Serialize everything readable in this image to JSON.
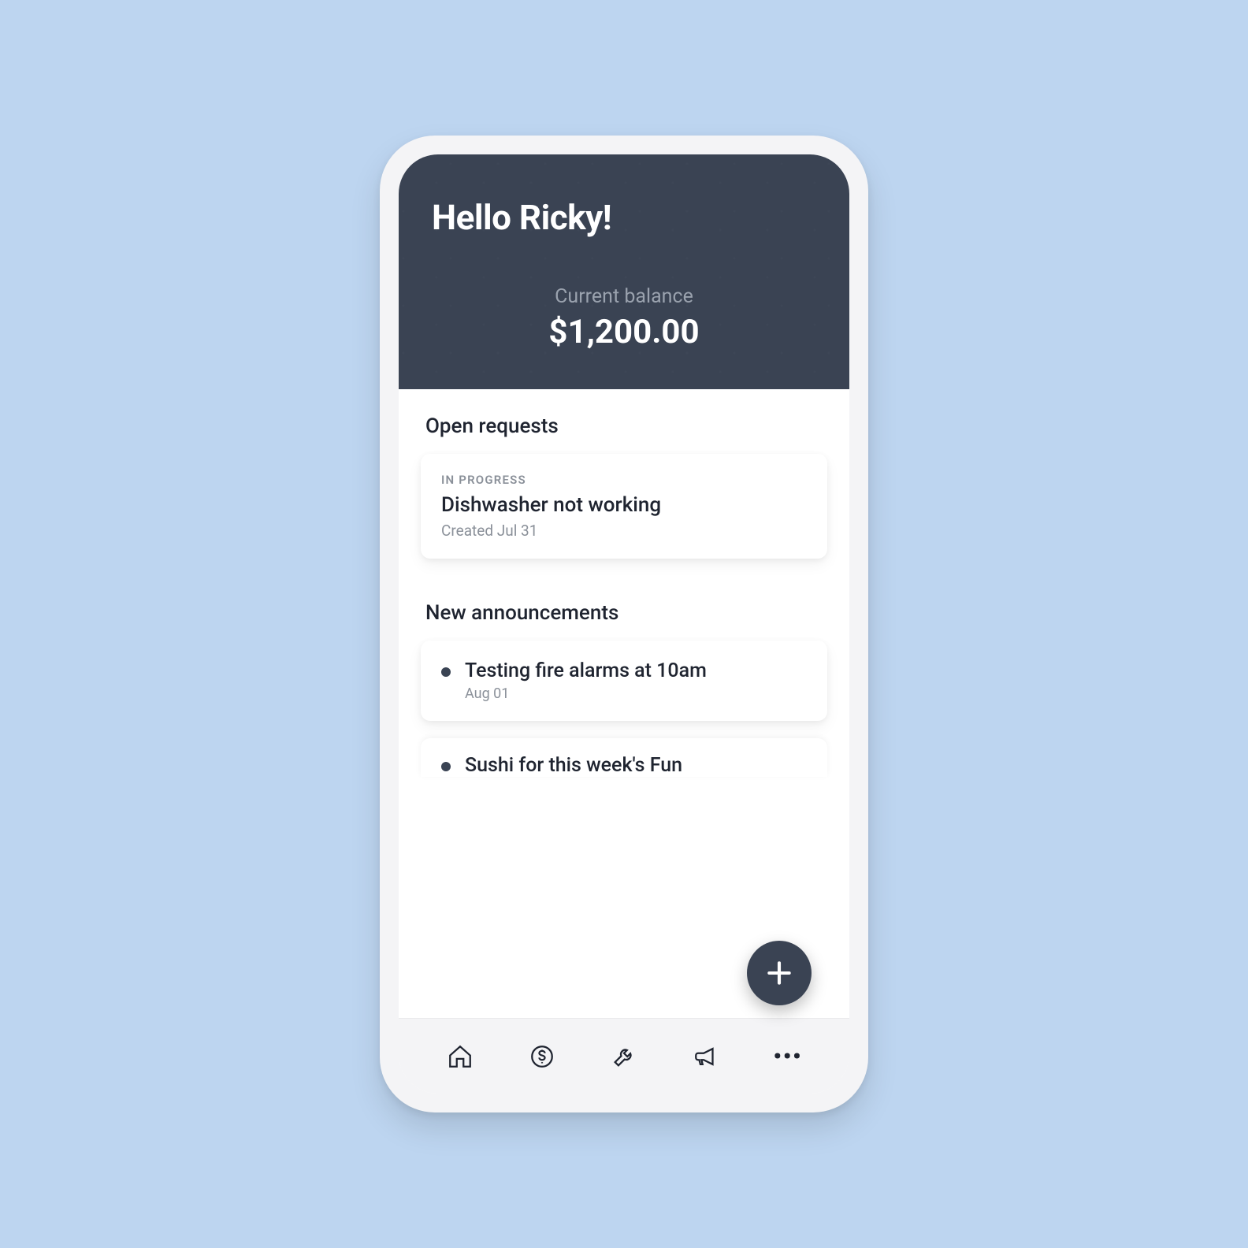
{
  "header": {
    "greeting": "Hello Ricky!",
    "balance_label": "Current balance",
    "balance_value": "$1,200.00"
  },
  "sections": {
    "open_requests_title": "Open requests",
    "announcements_title": "New announcements"
  },
  "requests": [
    {
      "status": "IN PROGRESS",
      "title": "Dishwasher not working",
      "created": "Created Jul 31"
    }
  ],
  "announcements": [
    {
      "title": "Testing fire alarms at 10am",
      "date": "Aug 01"
    },
    {
      "title": "Sushi for this week's Fun",
      "date": ""
    }
  ],
  "nav": {
    "items": [
      "home",
      "payments",
      "maintenance",
      "announcements",
      "more"
    ]
  }
}
